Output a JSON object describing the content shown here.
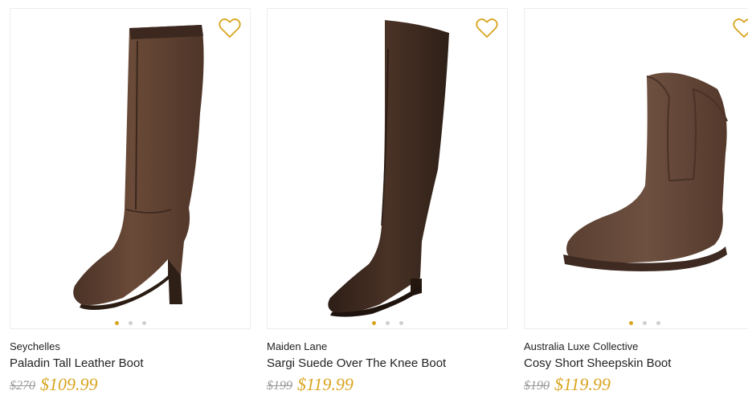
{
  "products": [
    {
      "brand": "Seychelles",
      "name": "Paladin Tall Leather Boot",
      "original_price": "$270",
      "sale_price": "$109.99",
      "image_icon": "tall-leather-boot",
      "carousel": {
        "count": 3,
        "active": 0
      }
    },
    {
      "brand": "Maiden Lane",
      "name": "Sargi Suede Over The Knee Boot",
      "original_price": "$199",
      "sale_price": "$119.99",
      "image_icon": "over-the-knee-boot",
      "carousel": {
        "count": 3,
        "active": 0
      }
    },
    {
      "brand": "Australia Luxe Collective",
      "name": "Cosy Short Sheepskin Boot",
      "original_price": "$190",
      "sale_price": "$119.99",
      "image_icon": "sheepskin-boot",
      "carousel": {
        "count": 3,
        "active": 0
      }
    }
  ],
  "colors": {
    "accent": "#d9a520",
    "text": "#222222",
    "strike": "#999999",
    "boot_brown": "#5b3f30",
    "boot_dark": "#3e2a20"
  },
  "icons": {
    "favorite": "heart-outline-icon"
  }
}
